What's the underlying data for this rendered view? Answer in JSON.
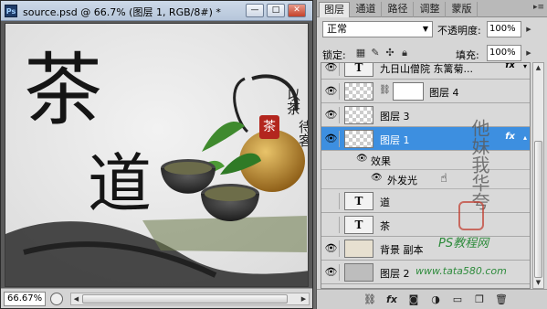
{
  "document_window": {
    "app_badge": "Ps",
    "title": "source.psd @ 66.7% (图层 1, RGB/8#) *",
    "buttons": {
      "minimize": "—",
      "maximize": "□",
      "close": "✕"
    },
    "canvas_text": {
      "big_char_1": "茶",
      "big_char_2": "道",
      "vertical_1": "以茶",
      "vertical_2": "待客",
      "seal": "茶",
      "vertical_3": "丹心",
      "vertical_4": "茶道"
    },
    "zoom": "66.67%"
  },
  "layers_panel": {
    "tabs": [
      "图层",
      "通道",
      "路径",
      "调整",
      "蒙版"
    ],
    "active_tab": 0,
    "blend_mode": "正常",
    "opacity_label": "不透明度:",
    "opacity_value": "100%",
    "lock_label": "锁定:",
    "fill_label": "填充:",
    "fill_value": "100%",
    "layers": [
      {
        "name": "九日山僧院   东篱菊...",
        "visible": true,
        "type": "text",
        "fx": true
      },
      {
        "name": "图层 4",
        "visible": true,
        "type": "masked",
        "fx": false
      },
      {
        "name": "图层 3",
        "visible": true,
        "type": "image",
        "fx": false
      },
      {
        "name": "图层 1",
        "visible": true,
        "type": "image",
        "fx": true,
        "selected": true
      },
      {
        "name": "道",
        "visible": false,
        "type": "text",
        "fx": false
      },
      {
        "name": "茶",
        "visible": false,
        "type": "text",
        "fx": false
      },
      {
        "name": "背景 副本",
        "visible": true,
        "type": "bg",
        "fx": false
      },
      {
        "name": "图层 2",
        "visible": true,
        "type": "plain",
        "fx": false
      }
    ],
    "effects_label": "效果",
    "effect_item": "外发光",
    "text_thumb_label": "T"
  },
  "watermark": {
    "signature_chars": "他妹我华夸",
    "site_name": "PS教程网",
    "site_url": "www.tata580.com"
  },
  "colors": {
    "selected_row": "#3d8fe0",
    "panel_bg": "#d6d6d6",
    "watermark_green": "#2e8b3c"
  }
}
